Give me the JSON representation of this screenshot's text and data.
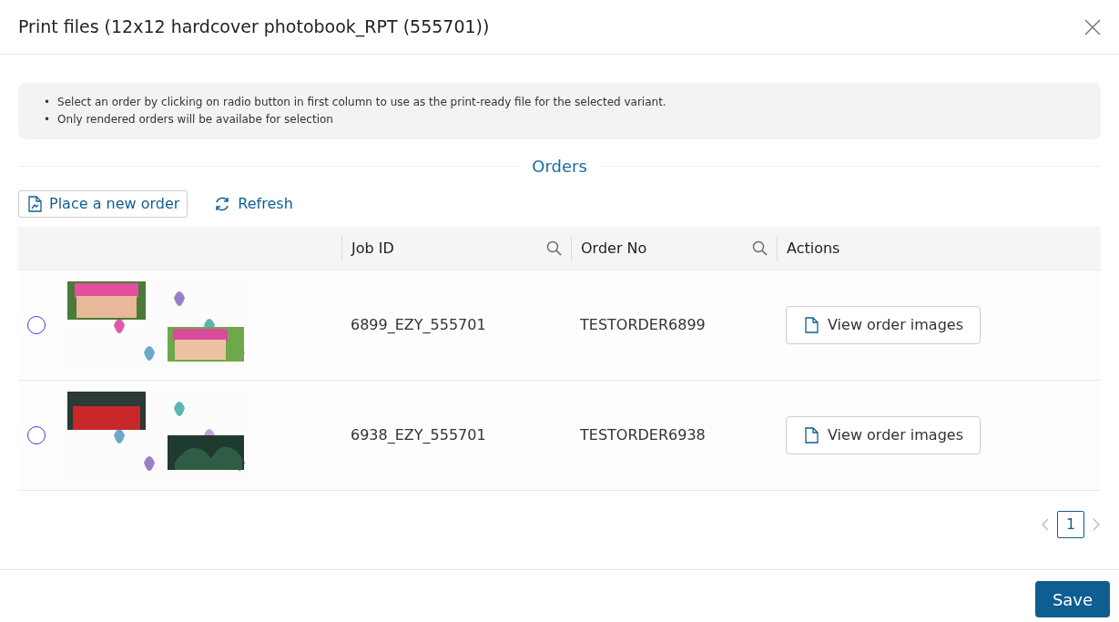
{
  "dialog": {
    "title": "Print files (12x12 hardcover photobook_RPT (555701))"
  },
  "notes": [
    {
      "marker": "•",
      "text": "Select an order by clicking on radio button in first column to use as the print-ready file for the selected variant."
    },
    {
      "marker": "•",
      "text": "Only rendered orders will be availabe for selection"
    }
  ],
  "section_title": "Orders",
  "toolbar": [
    {
      "kind": "outlined",
      "label": "Place a new order"
    },
    {
      "kind": "plain",
      "label": "Refresh"
    }
  ],
  "table": {
    "columns": [
      {
        "label": "Job ID",
        "searchable": true
      },
      {
        "label": "Order No",
        "searchable": true
      },
      {
        "label": "Actions",
        "searchable": false
      }
    ],
    "rows": [
      {
        "selected": false,
        "job_id": "6899_EZY_555701",
        "order_no": "TESTORDER6899",
        "action": "View order images"
      },
      {
        "selected": false,
        "job_id": "6938_EZY_555701",
        "order_no": "TESTORDER6938",
        "action": "View order images"
      }
    ]
  },
  "pagination": {
    "pages": [
      {
        "label": "1",
        "selected": true
      }
    ]
  },
  "footer": {
    "buttons": [
      "Save"
    ]
  }
}
